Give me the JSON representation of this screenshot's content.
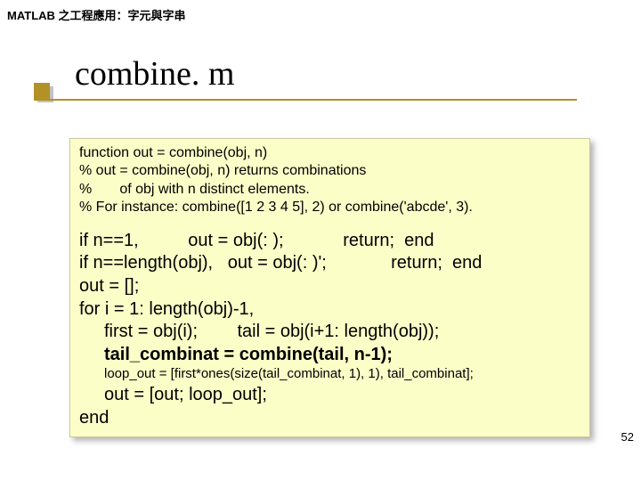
{
  "header": "MATLAB 之工程應用：字元與字串",
  "title": "combine. m",
  "code": {
    "fn1": "function out = combine(obj, n)",
    "fn2": "% out = combine(obj, n) returns combinations",
    "fn3": "%       of obj with n distinct elements.",
    "fn4": "% For instance: combine([1 2 3 4 5], 2) or combine('abcde', 3).",
    "b1": "if n==1,          out = obj(: );            return;  end",
    "b2": "if n==length(obj),   out = obj(: )';             return;  end",
    "b3": "out = [];",
    "b4": "for i = 1: length(obj)-1,",
    "b5": "first = obj(i);        tail = obj(i+1: length(obj));",
    "b6": "tail_combinat = combine(tail, n-1);",
    "s1": "loop_out = [first*ones(size(tail_combinat, 1), 1), tail_combinat];",
    "t1": "out = [out; loop_out];",
    "t2": "end"
  },
  "pagenum": "52"
}
